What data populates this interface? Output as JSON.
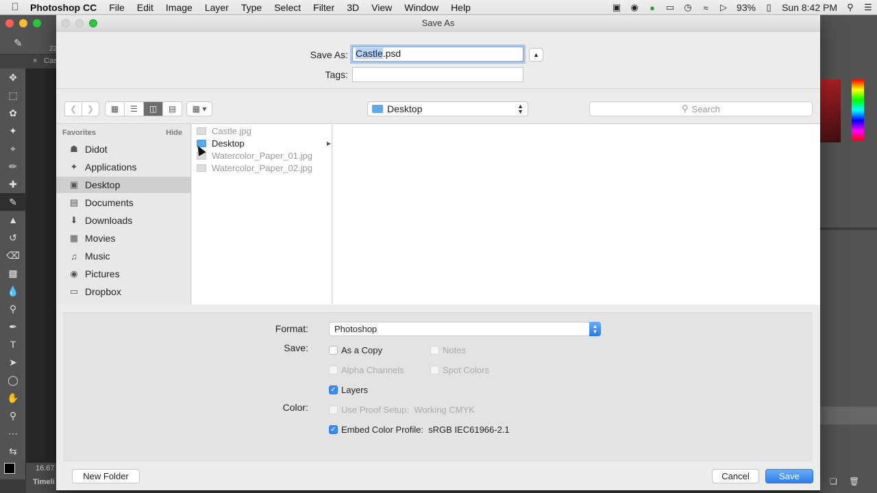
{
  "menubar": {
    "app_name": "Photoshop CC",
    "menus": [
      "File",
      "Edit",
      "Image",
      "Layer",
      "Type",
      "Select",
      "Filter",
      "3D",
      "View",
      "Window",
      "Help"
    ],
    "battery": "93%",
    "clock": "Sun 8:42 PM"
  },
  "background_app": {
    "doc_tab_prefix": "Cas",
    "zoom": "16.67",
    "timeline_tab": "Timeli",
    "size_prefix": "22"
  },
  "dialog": {
    "title": "Save As",
    "save_as_label": "Save As:",
    "filename_selected": "Castle",
    "filename_ext": ".psd",
    "tags_label": "Tags:",
    "location": "Desktop",
    "search_placeholder": "Search",
    "sidebar": {
      "section": "Favorites",
      "hide": "Hide",
      "items": [
        {
          "label": "Didot",
          "icon": "user-icon"
        },
        {
          "label": "Applications",
          "icon": "applications-icon"
        },
        {
          "label": "Desktop",
          "icon": "desktop-icon",
          "selected": true
        },
        {
          "label": "Documents",
          "icon": "documents-icon"
        },
        {
          "label": "Downloads",
          "icon": "downloads-icon"
        },
        {
          "label": "Movies",
          "icon": "movies-icon"
        },
        {
          "label": "Music",
          "icon": "music-icon"
        },
        {
          "label": "Pictures",
          "icon": "pictures-icon"
        },
        {
          "label": "Dropbox",
          "icon": "folder-icon"
        }
      ]
    },
    "files": [
      {
        "name": "Castle.jpg",
        "type": "file",
        "enabled": false
      },
      {
        "name": "Desktop",
        "type": "folder",
        "enabled": true
      },
      {
        "name": "Watercolor_Paper_01.jpg",
        "type": "file",
        "enabled": false
      },
      {
        "name": "Watercolor_Paper_02.jpg",
        "type": "file",
        "enabled": false
      }
    ],
    "options": {
      "format_label": "Format:",
      "format_value": "Photoshop",
      "save_label": "Save:",
      "as_a_copy": "As a Copy",
      "notes": "Notes",
      "alpha_channels": "Alpha Channels",
      "spot_colors": "Spot Colors",
      "layers": "Layers",
      "color_label": "Color:",
      "use_proof_setup": "Use Proof Setup:  Working CMYK",
      "embed_color_profile": "Embed Color Profile:  sRGB IEC61966-2.1"
    },
    "buttons": {
      "new_folder": "New Folder",
      "cancel": "Cancel",
      "save": "Save"
    }
  },
  "colors": {
    "accent": "#3b8cf2",
    "selection": "#b5d3fc",
    "ps_panel": "#535353"
  }
}
